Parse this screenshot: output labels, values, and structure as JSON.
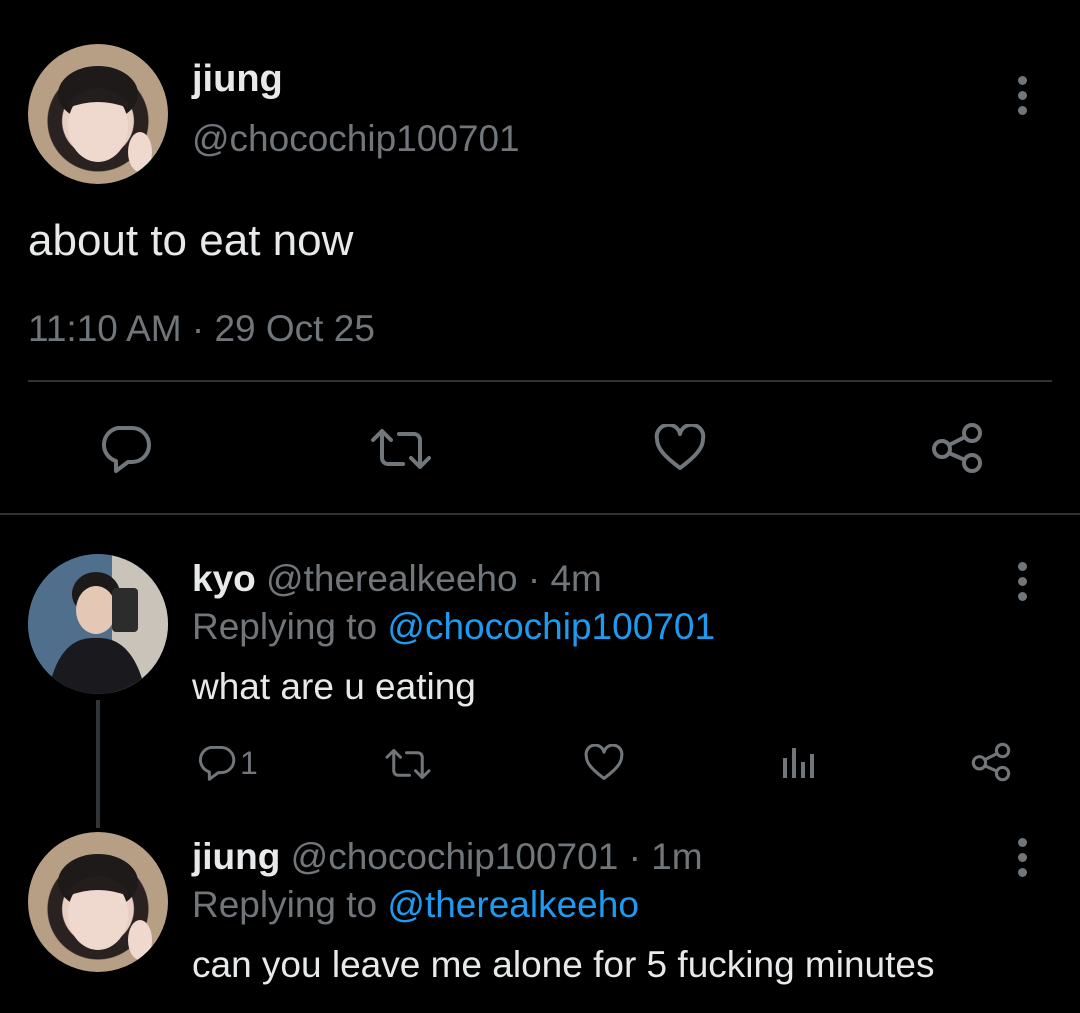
{
  "main_tweet": {
    "display_name": "jiung",
    "handle": "@chocochip100701",
    "text": "about to eat now",
    "timestamp": "11:10 AM · 29 Oct 25",
    "actions": [
      "reply-icon",
      "retweet-icon",
      "like-icon",
      "share-icon"
    ]
  },
  "replies": [
    {
      "display_name": "kyo",
      "handle": "@therealkeeho",
      "time": "· 4m",
      "replying_to_label": "Replying to",
      "replying_to_handle": "@chocochip100701",
      "text": "what are u eating",
      "reply_count": "1",
      "actions": [
        "reply-icon",
        "retweet-icon",
        "like-icon",
        "views-icon",
        "share-icon"
      ]
    },
    {
      "display_name": "jiung",
      "handle": "@chocochip100701",
      "time": "· 1m",
      "replying_to_label": "Replying to",
      "replying_to_handle": "@therealkeeho",
      "text": "can you leave me alone for 5 fucking minutes"
    }
  ],
  "colors": {
    "background": "#000000",
    "text": "#e7e9ea",
    "muted": "#71767b",
    "link": "#1d9bf0",
    "divider": "#2f3336"
  }
}
